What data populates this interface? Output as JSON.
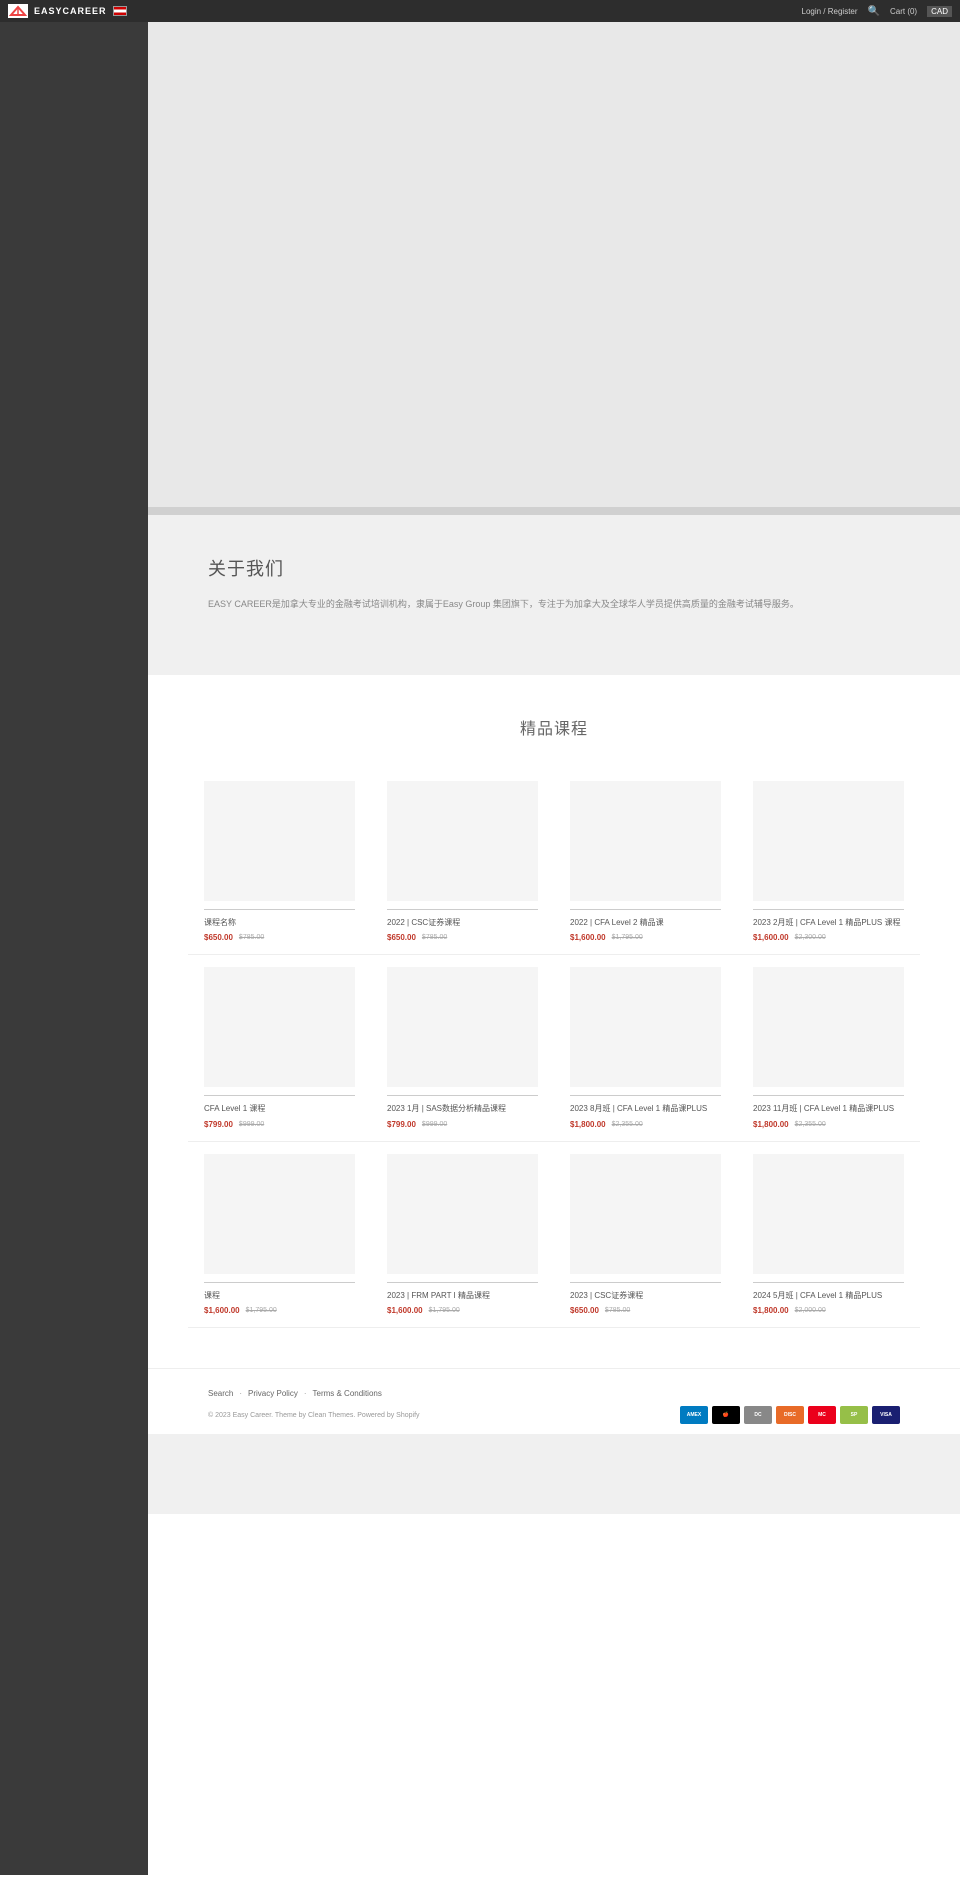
{
  "header": {
    "logo_text": "EASYCAREER",
    "nav_login": "Login / Register",
    "cart_label": "Cart (0)",
    "currency": "CAD"
  },
  "about": {
    "title": "关于我们",
    "description": "EASY CAREER是加拿大专业的金融考试培训机构，隶属于Easy Group 集团旗下，专注于为加拿大及全球华人学员提供高质量的金融考试辅导服务。"
  },
  "products_section": {
    "title": "精品课程"
  },
  "products": [
    {
      "name": "课程名称",
      "price": "$650.00",
      "original_price": "$785.00"
    },
    {
      "name": "2022 | CSC证券课程",
      "price": "$650.00",
      "original_price": "$785.00"
    },
    {
      "name": "2022 | CFA Level 2 精品课",
      "price": "$1,600.00",
      "original_price": "$1,795.00"
    },
    {
      "name": "2023 2月班 | CFA Level 1 精品PLUS 课程",
      "price": "$1,600.00",
      "original_price": "$2,300.00"
    },
    {
      "name": "CFA Level 1 课程",
      "price": "$799.00",
      "original_price": "$999.00"
    },
    {
      "name": "2023 1月 | SAS数据分析精品课程",
      "price": "$799.00",
      "original_price": "$999.00"
    },
    {
      "name": "2023 8月班 | CFA Level 1 精品课PLUS",
      "price": "$1,800.00",
      "original_price": "$2,355.00"
    },
    {
      "name": "2023 11月班 | CFA Level 1 精品课PLUS",
      "price": "$1,800.00",
      "original_price": "$2,355.00"
    },
    {
      "name": "课程",
      "price": "$1,600.00",
      "original_price": "$1,795.00"
    },
    {
      "name": "2023 | FRM PART I 精品课程",
      "price": "$1,600.00",
      "original_price": "$1,795.00"
    },
    {
      "name": "2023 | CSC证券课程",
      "price": "$650.00",
      "original_price": "$785.00"
    },
    {
      "name": "2024 5月班 | CFA Level 1 精品PLUS",
      "price": "$1,800.00",
      "original_price": "$2,000.00"
    }
  ],
  "footer": {
    "links": [
      "Search",
      "Privacy Policy",
      "Terms & Conditions"
    ],
    "copyright": "© 2023 Easy Career. Theme by Clean Themes. Powered by Shopify",
    "payment_methods": [
      "AMEX",
      "Apple Pay",
      "Diners",
      "Discover",
      "MC",
      "Shopify",
      "VISA"
    ]
  }
}
